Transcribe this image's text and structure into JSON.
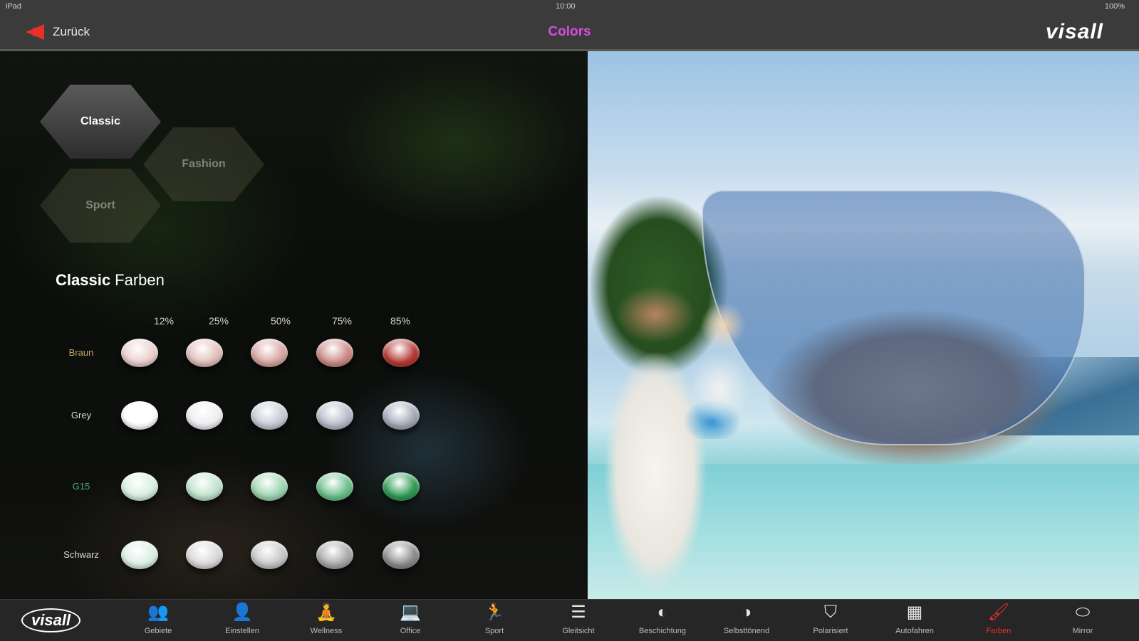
{
  "status": {
    "left": "iPad",
    "time": "10:00",
    "battery": "100%"
  },
  "nav": {
    "back_label": "Zurück",
    "title": "Colors",
    "brand": "visall"
  },
  "categories": [
    {
      "label": "Classic",
      "active": true
    },
    {
      "label": "Fashion",
      "active": false
    },
    {
      "label": "Sport",
      "active": false
    }
  ],
  "section": {
    "title_bold": "Classic",
    "title_light": " Farben"
  },
  "percentages": [
    "12%",
    "25%",
    "50%",
    "75%",
    "85%"
  ],
  "rows": [
    {
      "label": "Braun",
      "label_color": "#c9a36b",
      "swatches": [
        "#e9d0cc",
        "#e2c0bc",
        "#d7a7a3",
        "#cc8b87",
        "#b53a36"
      ]
    },
    {
      "label": "Grey",
      "label_color": "#d9d9d9",
      "swatches": [
        "#ffffff",
        "#eeeef2",
        "#c7cad6",
        "#b8bcca",
        "#a5aab8"
      ]
    },
    {
      "label": "G15",
      "label_color": "#3fb36a",
      "swatches": [
        "#d8eee0",
        "#bfe3cc",
        "#9fd5b2",
        "#6cbf8c",
        "#2f9b55"
      ]
    },
    {
      "label": "Schwarz",
      "label_color": "#d9d9d9",
      "swatches": [
        "#dcefe6",
        "#d9d9d9",
        "#c7c7c7",
        "#a9a9a9",
        "#8c8c8c"
      ]
    }
  ],
  "toolbar": {
    "logo": "visall",
    "items": [
      {
        "label": "Gebiete",
        "icon": "people-icon"
      },
      {
        "label": "Einstellen",
        "icon": "person-icon"
      },
      {
        "label": "Wellness",
        "icon": "wellness-icon"
      },
      {
        "label": "Office",
        "icon": "office-icon"
      },
      {
        "label": "Sport",
        "icon": "sport-icon"
      },
      {
        "label": "Gleitsicht",
        "icon": "progressive-lens-icon"
      },
      {
        "label": "Beschichtung",
        "icon": "coating-icon"
      },
      {
        "label": "Selbsttönend",
        "icon": "photochromic-icon"
      },
      {
        "label": "Polarisiert",
        "icon": "polarized-icon"
      },
      {
        "label": "Autofahren",
        "icon": "driving-icon"
      },
      {
        "label": "Farben",
        "icon": "colors-icon",
        "active": true
      },
      {
        "label": "Mirror",
        "icon": "mirror-icon"
      }
    ]
  }
}
